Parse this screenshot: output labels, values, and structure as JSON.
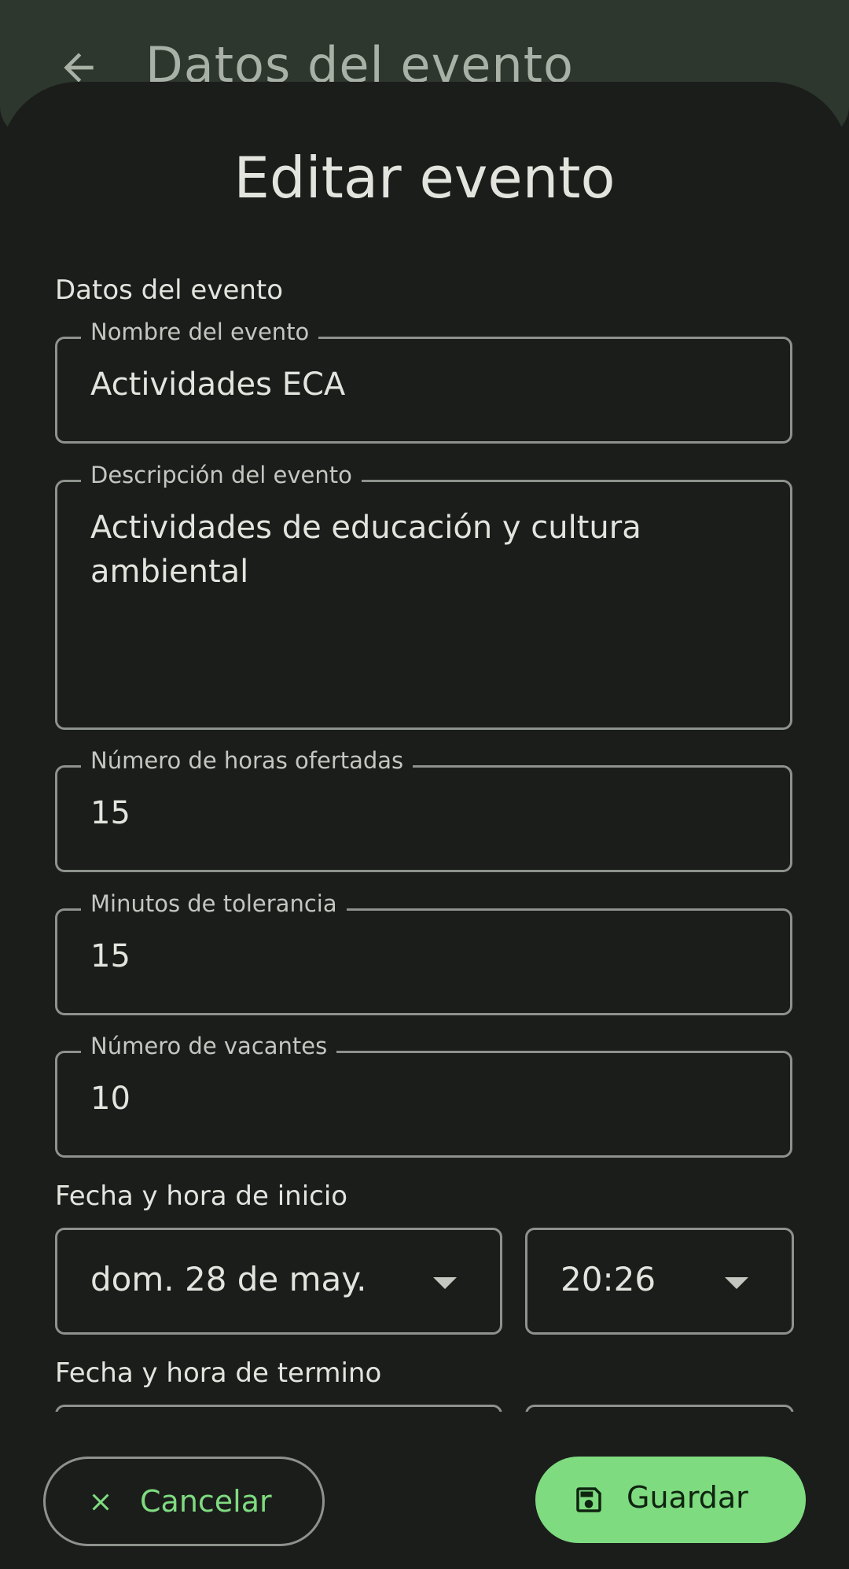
{
  "app_bar": {
    "title": "Datos del evento",
    "back_icon": "arrow-back-icon"
  },
  "sheet": {
    "title": "Editar evento",
    "section_event_data": "Datos del evento",
    "fields": {
      "name": {
        "label": "Nombre del evento",
        "value": "Actividades ECA"
      },
      "description": {
        "label": "Descripción del evento",
        "value": "Actividades de educación y cultura ambiental"
      },
      "hours": {
        "label": "Número de horas ofertadas",
        "value": "15"
      },
      "tolerance": {
        "label": "Minutos de tolerancia",
        "value": "15"
      },
      "vacancies": {
        "label": "Número de vacantes",
        "value": "10"
      }
    },
    "start": {
      "label": "Fecha y hora de inicio",
      "date": "dom. 28 de may.",
      "time": "20:26"
    },
    "end": {
      "label": "Fecha y hora de termino"
    }
  },
  "actions": {
    "cancel_label": "Cancelar",
    "cancel_icon": "close-icon",
    "save_label": "Guardar",
    "save_icon": "save-icon"
  },
  "colors": {
    "background": "#1b1d1b",
    "app_bar": "#2d372d",
    "accent": "#7fdb80",
    "outline": "#8e928d"
  }
}
